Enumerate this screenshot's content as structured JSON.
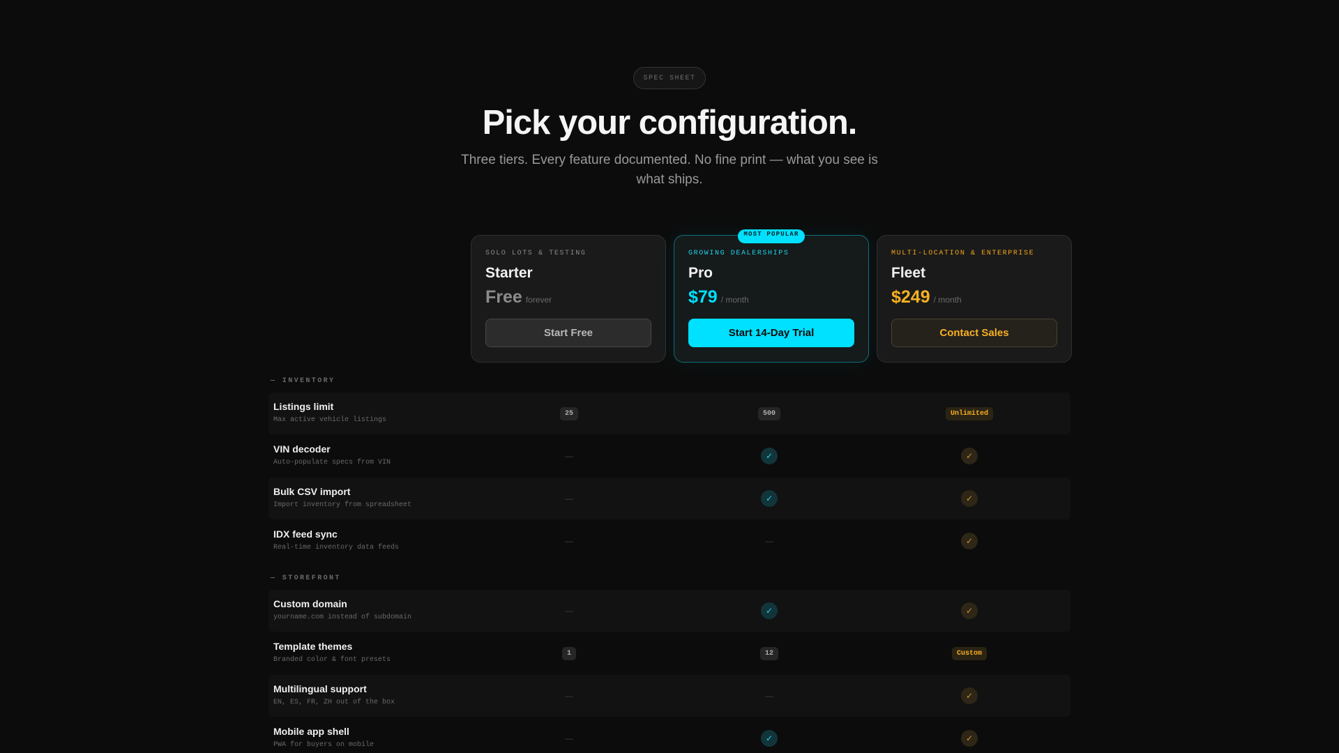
{
  "header": {
    "badge": "SPEC SHEET",
    "title": "Pick your configuration.",
    "subtitle": "Three tiers. Every feature documented. No fine print — what you see is what ships."
  },
  "colors": {
    "accent_cyan": "#00e0ff",
    "accent_gold": "#f7b022",
    "background": "#0c0c0c"
  },
  "plans": {
    "starter": {
      "tag": "SOLO LOTS & TESTING",
      "name": "Starter",
      "price": "Free",
      "period": "forever",
      "cta": "Start Free"
    },
    "pro": {
      "badge": "MOST POPULAR",
      "tag": "GROWING DEALERSHIPS",
      "name": "Pro",
      "price": "$79",
      "period": "/ month",
      "cta": "Start 14-Day Trial"
    },
    "fleet": {
      "tag": "MULTI-LOCATION & ENTERPRISE",
      "name": "Fleet",
      "price": "$249",
      "period": "/ month",
      "cta": "Contact Sales"
    }
  },
  "sections": {
    "inventory": {
      "label": "— INVENTORY",
      "rows": [
        {
          "name": "Listings limit",
          "desc": "Max active vehicle listings",
          "starter": "25",
          "pro": "500",
          "fleet": "Unlimited"
        },
        {
          "name": "VIN decoder",
          "desc": "Auto-populate specs from VIN",
          "starter": "—",
          "pro": "check-icon",
          "fleet": "check-icon"
        },
        {
          "name": "Bulk CSV import",
          "desc": "Import inventory from spreadsheet",
          "starter": "—",
          "pro": "check-icon",
          "fleet": "check-icon"
        },
        {
          "name": "IDX feed sync",
          "desc": "Real-time inventory data feeds",
          "starter": "—",
          "pro": "—",
          "fleet": "check-icon"
        }
      ]
    },
    "storefront": {
      "label": "— STOREFRONT",
      "rows": [
        {
          "name": "Custom domain",
          "desc": "yourname.com instead of subdomain",
          "starter": "—",
          "pro": "check-icon",
          "fleet": "check-icon"
        },
        {
          "name": "Template themes",
          "desc": "Branded color & font presets",
          "starter": "1",
          "pro": "12",
          "fleet": "Custom"
        },
        {
          "name": "Multilingual support",
          "desc": "EN, ES, FR, ZH out of the box",
          "starter": "—",
          "pro": "—",
          "fleet": "check-icon"
        },
        {
          "name": "Mobile app shell",
          "desc": "PWA for buyers on mobile",
          "starter": "—",
          "pro": "check-icon",
          "fleet": "check-icon"
        }
      ]
    }
  }
}
